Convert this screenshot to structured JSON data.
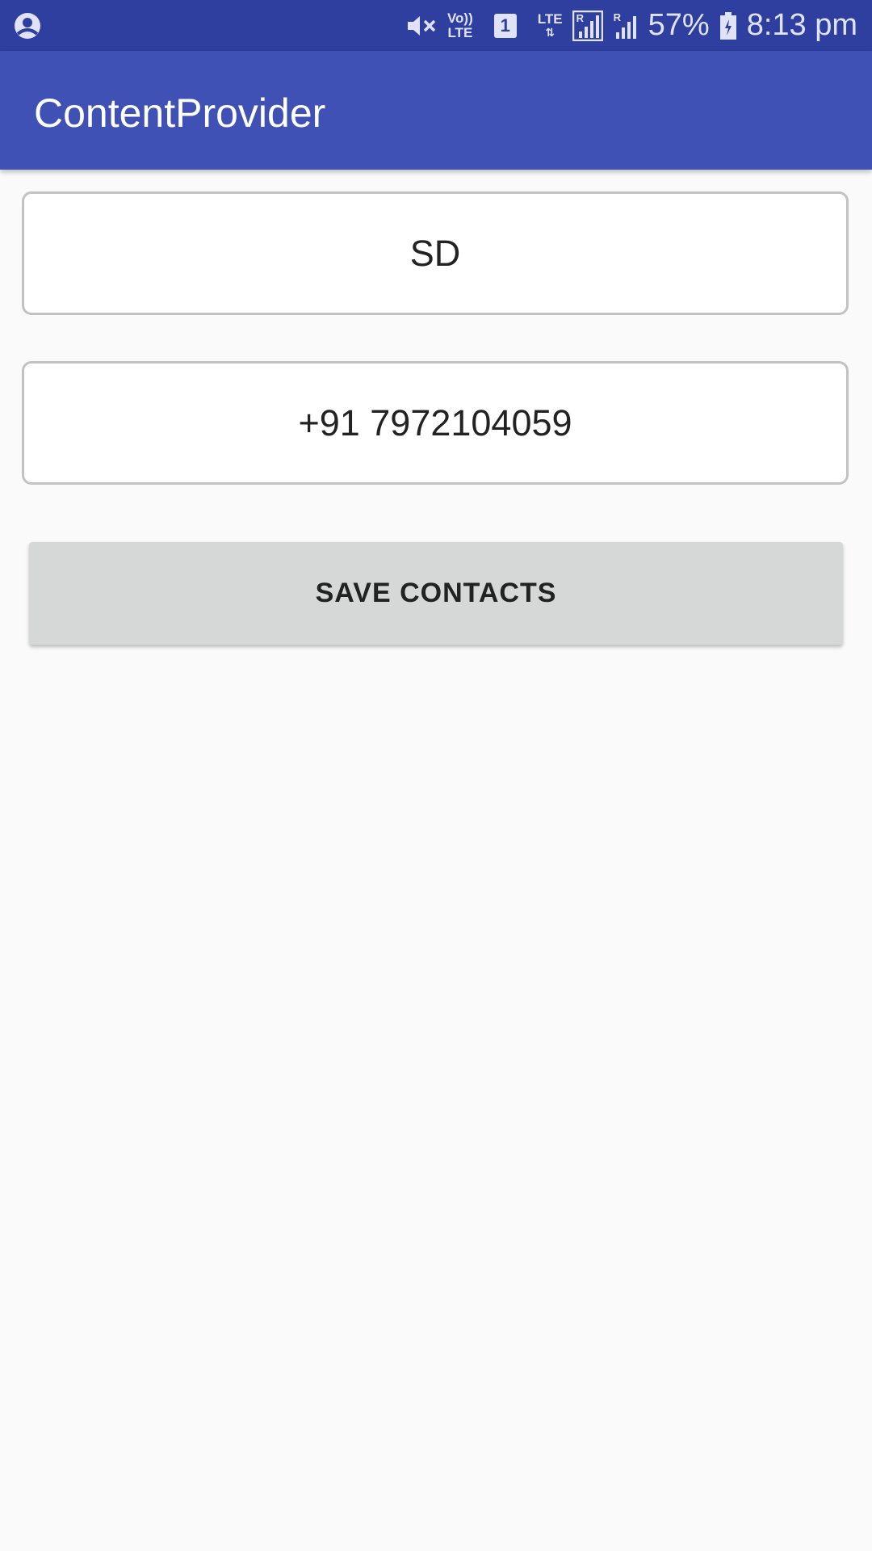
{
  "status_bar": {
    "battery_percent": "57%",
    "time": "8:13 pm",
    "volte_label_top": "Vo))",
    "volte_label_bottom": "LTE",
    "sim_label": "1",
    "lte_label": "LTE",
    "roaming_label_1": "R",
    "roaming_label_2": "R",
    "icons": [
      "app-notification-icon",
      "mute-icon",
      "volte-icon",
      "sim-1-icon",
      "lte-data-icon",
      "signal-icon",
      "signal-icon",
      "battery-icon"
    ]
  },
  "app_bar": {
    "title": "ContentProvider",
    "color": "#3f51b5"
  },
  "form": {
    "name_value": "SD",
    "phone_value": "+91 7972104059",
    "save_label": "SAVE CONTACTS"
  }
}
